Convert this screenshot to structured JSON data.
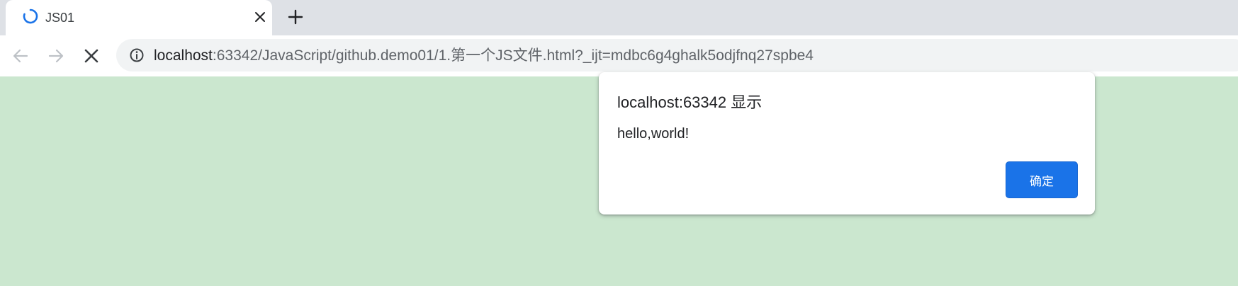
{
  "tab": {
    "title": "JS01",
    "loading_icon": "spinner-icon",
    "close_icon": "close-icon"
  },
  "new_tab_icon": "plus-icon",
  "toolbar": {
    "back_icon": "arrow-left-icon",
    "forward_icon": "arrow-right-icon",
    "stop_icon": "stop-icon",
    "info_icon": "info-icon",
    "url_host": "localhost",
    "url_rest": ":63342/JavaScript/github.demo01/1.第一个JS文件.html?_ijt=mdbc6g4ghalk5odjfnq27spbe4"
  },
  "dialog": {
    "title": "localhost:63342 显示",
    "message": "hello,world!",
    "ok_label": "确定"
  },
  "colors": {
    "page_background": "#cbe7cf",
    "tab_strip": "#dee1e6",
    "accent": "#1a73e8",
    "spinner": "#1a73e8"
  }
}
